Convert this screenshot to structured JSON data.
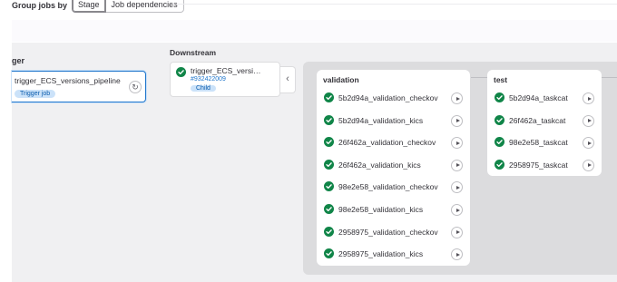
{
  "toolbar": {
    "group_label": "Group jobs by",
    "options": [
      "Stage",
      "Job dependencies"
    ],
    "selected": "Stage"
  },
  "upstream": {
    "title": "ger",
    "name": "trigger_ECS_versions_pipeline",
    "badge": "Trigger job"
  },
  "downstream": {
    "title": "Downstream",
    "name": "trigger_ECS_versi…",
    "id": "#932422009",
    "badge": "Child",
    "status": "success"
  },
  "stages": [
    {
      "name": "validation",
      "jobs": [
        {
          "name": "5b2d94a_validation_checkov",
          "status": "success"
        },
        {
          "name": "5b2d94a_validation_kics",
          "status": "success"
        },
        {
          "name": "26f462a_validation_checkov",
          "status": "success"
        },
        {
          "name": "26f462a_validation_kics",
          "status": "success"
        },
        {
          "name": "98e2e58_validation_checkov",
          "status": "success"
        },
        {
          "name": "98e2e58_validation_kics",
          "status": "success"
        },
        {
          "name": "2958975_validation_checkov",
          "status": "success"
        },
        {
          "name": "2958975_validation_kics",
          "status": "success"
        }
      ]
    },
    {
      "name": "test",
      "jobs": [
        {
          "name": "5b2d94a_taskcat",
          "status": "success"
        },
        {
          "name": "26f462a_taskcat",
          "status": "success"
        },
        {
          "name": "98e2e58_taskcat",
          "status": "success"
        },
        {
          "name": "2958975_taskcat",
          "status": "success"
        }
      ]
    }
  ],
  "colors": {
    "success": "#108548",
    "link": "#1f75cb",
    "badge_bg": "#cbe2f9",
    "canvas": "#f0f0f2",
    "inner": "#dcdcde"
  },
  "icons": {
    "job_status": "status-success-icon",
    "job_action": "play-icon",
    "retry": "retry-icon",
    "collapse": "chevron-left-icon"
  }
}
